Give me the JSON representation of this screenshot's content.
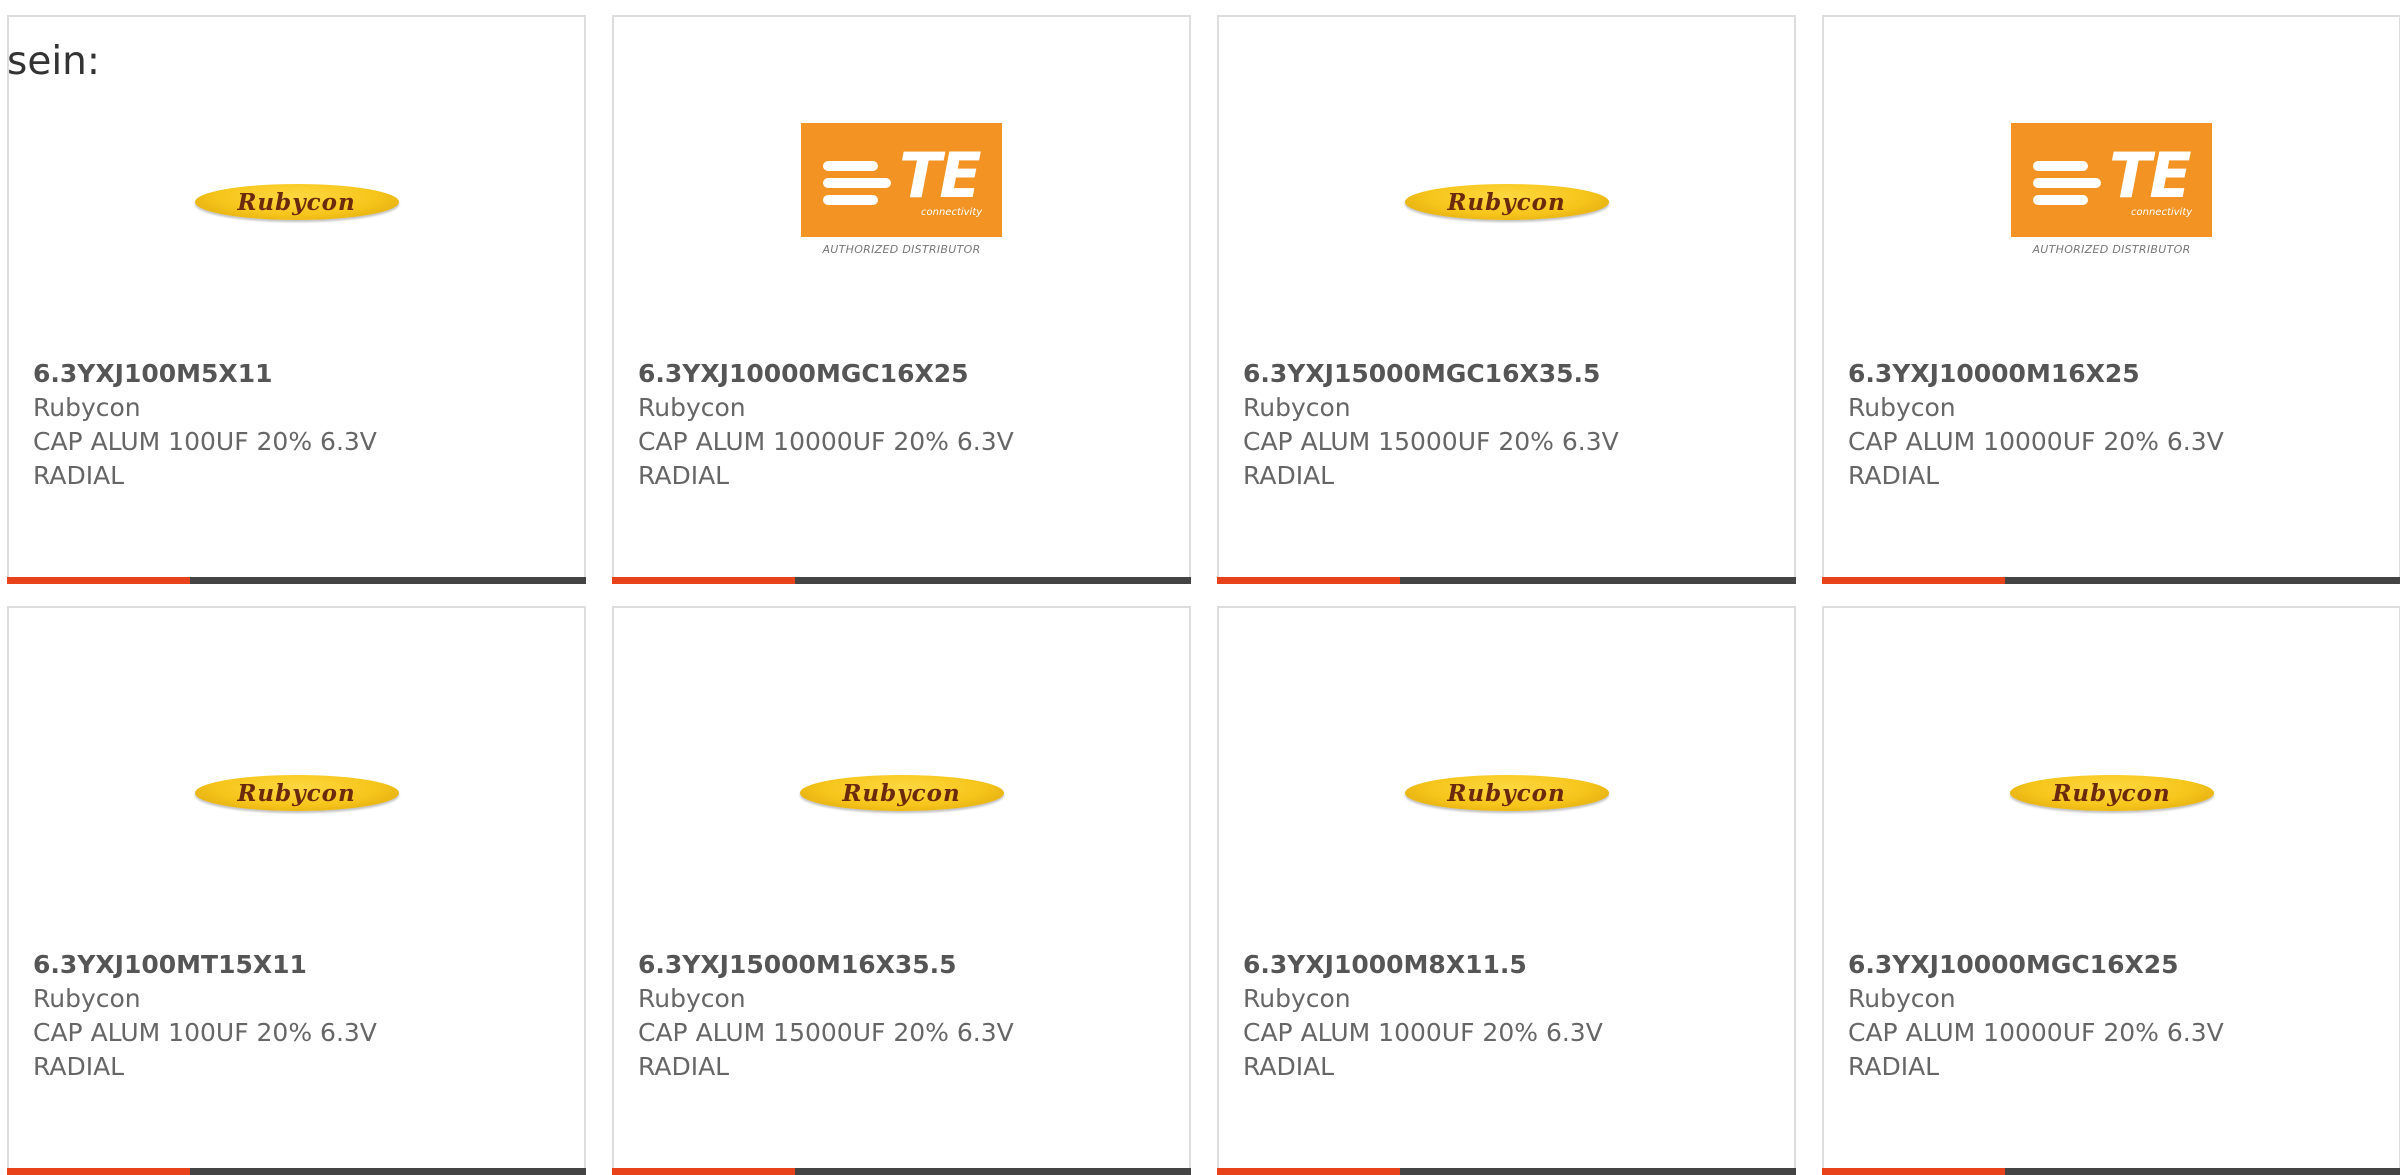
{
  "intro_text": "sein:",
  "accent_color": "#e8421b",
  "products": [
    {
      "part": "6.3YXJ100M5X11",
      "manufacturer": "Rubycon",
      "description": "CAP ALUM 100UF 20% 6.3V RADIAL",
      "logo": "rubycon-logo",
      "logo_text": "Rubycon"
    },
    {
      "part": "6.3YXJ10000MGC16X25",
      "manufacturer": "Rubycon",
      "description": "CAP ALUM 10000UF 20% 6.3V RADIAL",
      "logo": "te-connectivity-logo",
      "logo_text": "TE",
      "logo_subtext": "connectivity",
      "logo_caption": "AUTHORIZED DISTRIBUTOR"
    },
    {
      "part": "6.3YXJ15000MGC16X35.5",
      "manufacturer": "Rubycon",
      "description": "CAP ALUM 15000UF 20% 6.3V RADIAL",
      "logo": "rubycon-logo",
      "logo_text": "Rubycon"
    },
    {
      "part": "6.3YXJ10000M16X25",
      "manufacturer": "Rubycon",
      "description": "CAP ALUM 10000UF 20% 6.3V RADIAL",
      "logo": "te-connectivity-logo",
      "logo_text": "TE",
      "logo_subtext": "connectivity",
      "logo_caption": "AUTHORIZED DISTRIBUTOR"
    },
    {
      "part": "6.3YXJ100MT15X11",
      "manufacturer": "Rubycon",
      "description": "CAP ALUM 100UF 20% 6.3V RADIAL",
      "logo": "rubycon-logo",
      "logo_text": "Rubycon"
    },
    {
      "part": "6.3YXJ15000M16X35.5",
      "manufacturer": "Rubycon",
      "description": "CAP ALUM 15000UF 20% 6.3V RADIAL",
      "logo": "rubycon-logo",
      "logo_text": "Rubycon"
    },
    {
      "part": "6.3YXJ1000M8X11.5",
      "manufacturer": "Rubycon",
      "description": "CAP ALUM 1000UF 20% 6.3V RADIAL",
      "logo": "rubycon-logo",
      "logo_text": "Rubycon"
    },
    {
      "part": "6.3YXJ10000MGC16X25",
      "manufacturer": "Rubycon",
      "description": "CAP ALUM 10000UF 20% 6.3V RADIAL",
      "logo": "rubycon-logo",
      "logo_text": "Rubycon"
    }
  ]
}
